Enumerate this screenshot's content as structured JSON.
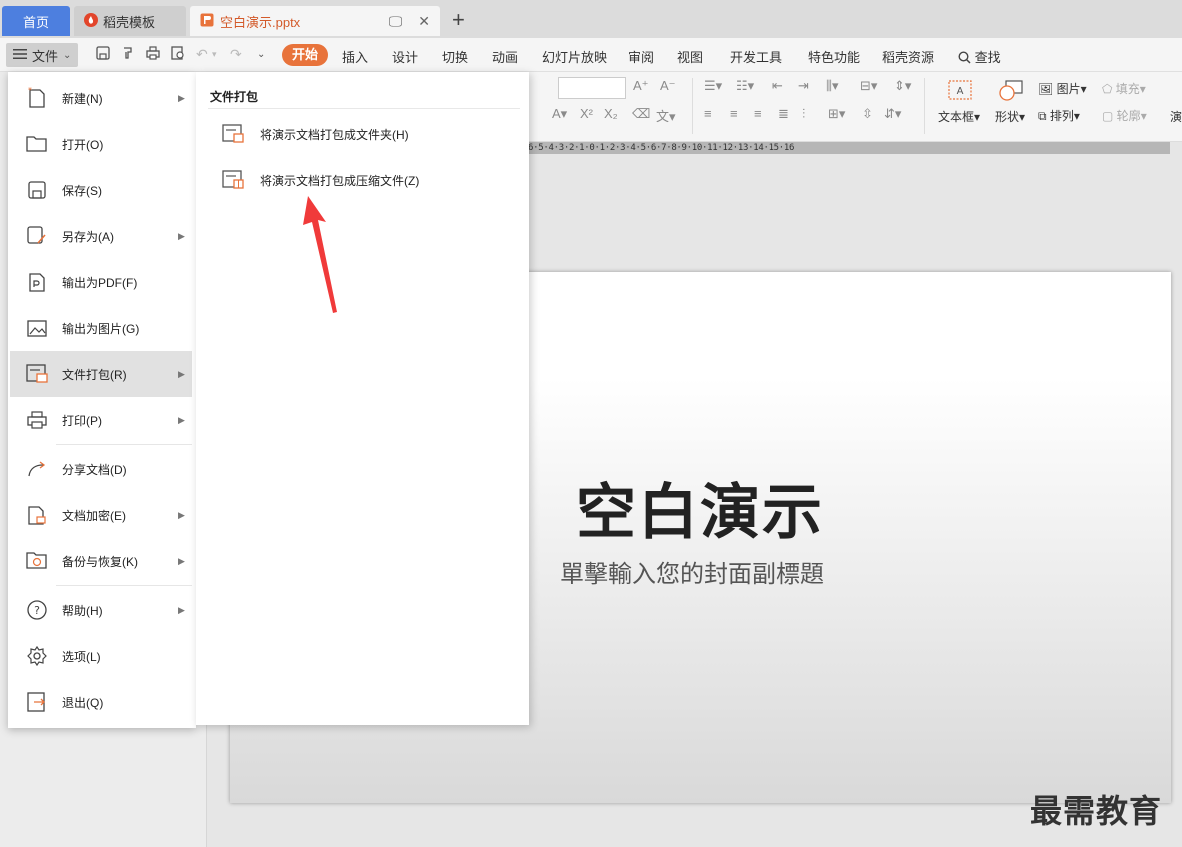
{
  "tabs": {
    "home": "首页",
    "template": "稻壳模板",
    "document": "空白演示.pptx"
  },
  "toolbar": {
    "file_label": "文件",
    "menus": [
      "开始",
      "插入",
      "设计",
      "切换",
      "动画",
      "幻灯片放映",
      "审阅",
      "视图",
      "开发工具",
      "特色功能",
      "稻壳资源"
    ],
    "search_label": "查找"
  },
  "ribbon": {
    "textbox": "文本框",
    "shape": "形状",
    "picture": "图片",
    "fill": "填充",
    "arrange": "排列",
    "outline": "轮廓",
    "more": "演"
  },
  "ruler": "6·5·4·3·2·1·0·1·2·3·4·5·6·7·8·9·10·11·12·13·14·15·16",
  "file_menu": {
    "items": [
      {
        "label": "新建(N)",
        "submenu": true
      },
      {
        "label": "打开(O)",
        "submenu": false
      },
      {
        "label": "保存(S)",
        "submenu": false
      },
      {
        "label": "另存为(A)",
        "submenu": true
      },
      {
        "label": "输出为PDF(F)",
        "submenu": false
      },
      {
        "label": "输出为图片(G)",
        "submenu": false
      },
      {
        "label": "文件打包(R)",
        "submenu": true
      },
      {
        "label": "打印(P)",
        "submenu": true
      },
      {
        "label": "分享文档(D)",
        "submenu": false
      },
      {
        "label": "文档加密(E)",
        "submenu": true
      },
      {
        "label": "备份与恢复(K)",
        "submenu": true
      },
      {
        "label": "帮助(H)",
        "submenu": true
      },
      {
        "label": "选项(L)",
        "submenu": false
      },
      {
        "label": "退出(Q)",
        "submenu": false
      }
    ]
  },
  "submenu": {
    "title": "文件打包",
    "items": [
      "将演示文档打包成文件夹(H)",
      "将演示文档打包成压缩文件(Z)"
    ]
  },
  "slide": {
    "title": "空白演示",
    "subtitle": "單擊輸入您的封面副標題"
  },
  "watermark": "最需教育",
  "colors": {
    "accent": "#e8733b",
    "home_tab": "#4d7fdf",
    "doc_tab_text": "#d35a2a",
    "annotation_arrow": "#f03a3a"
  }
}
